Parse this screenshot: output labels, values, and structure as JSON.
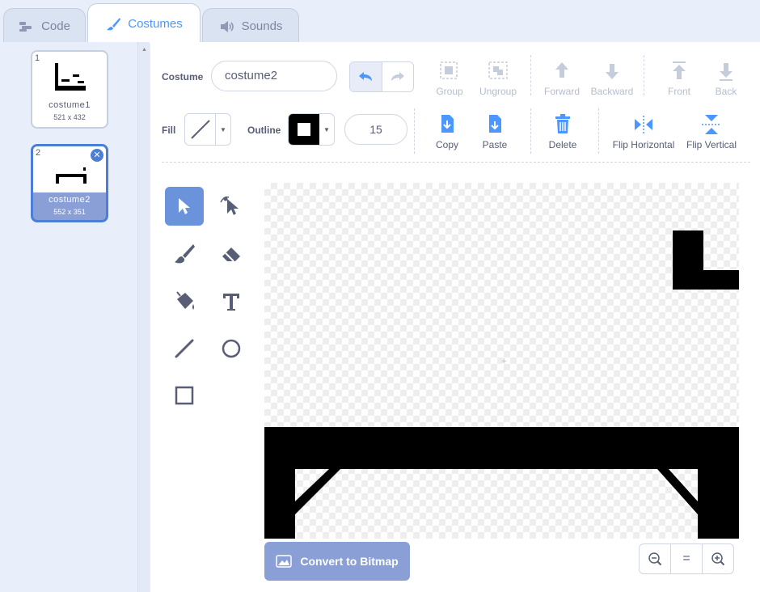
{
  "tabs": {
    "code": "Code",
    "costumes": "Costumes",
    "sounds": "Sounds"
  },
  "costumes": [
    {
      "number": "1",
      "name": "costume1",
      "size": "521 x 432"
    },
    {
      "number": "2",
      "name": "costume2",
      "size": "552 x 351"
    }
  ],
  "toolbar": {
    "costume_label": "Costume",
    "costume_name": "costume2",
    "group": "Group",
    "ungroup": "Ungroup",
    "forward": "Forward",
    "backward": "Backward",
    "front": "Front",
    "back": "Back",
    "fill_label": "Fill",
    "outline_label": "Outline",
    "outline_width": "15",
    "copy": "Copy",
    "paste": "Paste",
    "delete": "Delete",
    "flip_horizontal": "Flip Horizontal",
    "flip_vertical": "Flip Vertical"
  },
  "canvas": {
    "convert_label": "Convert to Bitmap",
    "zoom_reset": "="
  },
  "colors": {
    "accent": "#4c97ff",
    "selected_tool": "#6b93db",
    "costume_selected": "#8a9fd6"
  }
}
